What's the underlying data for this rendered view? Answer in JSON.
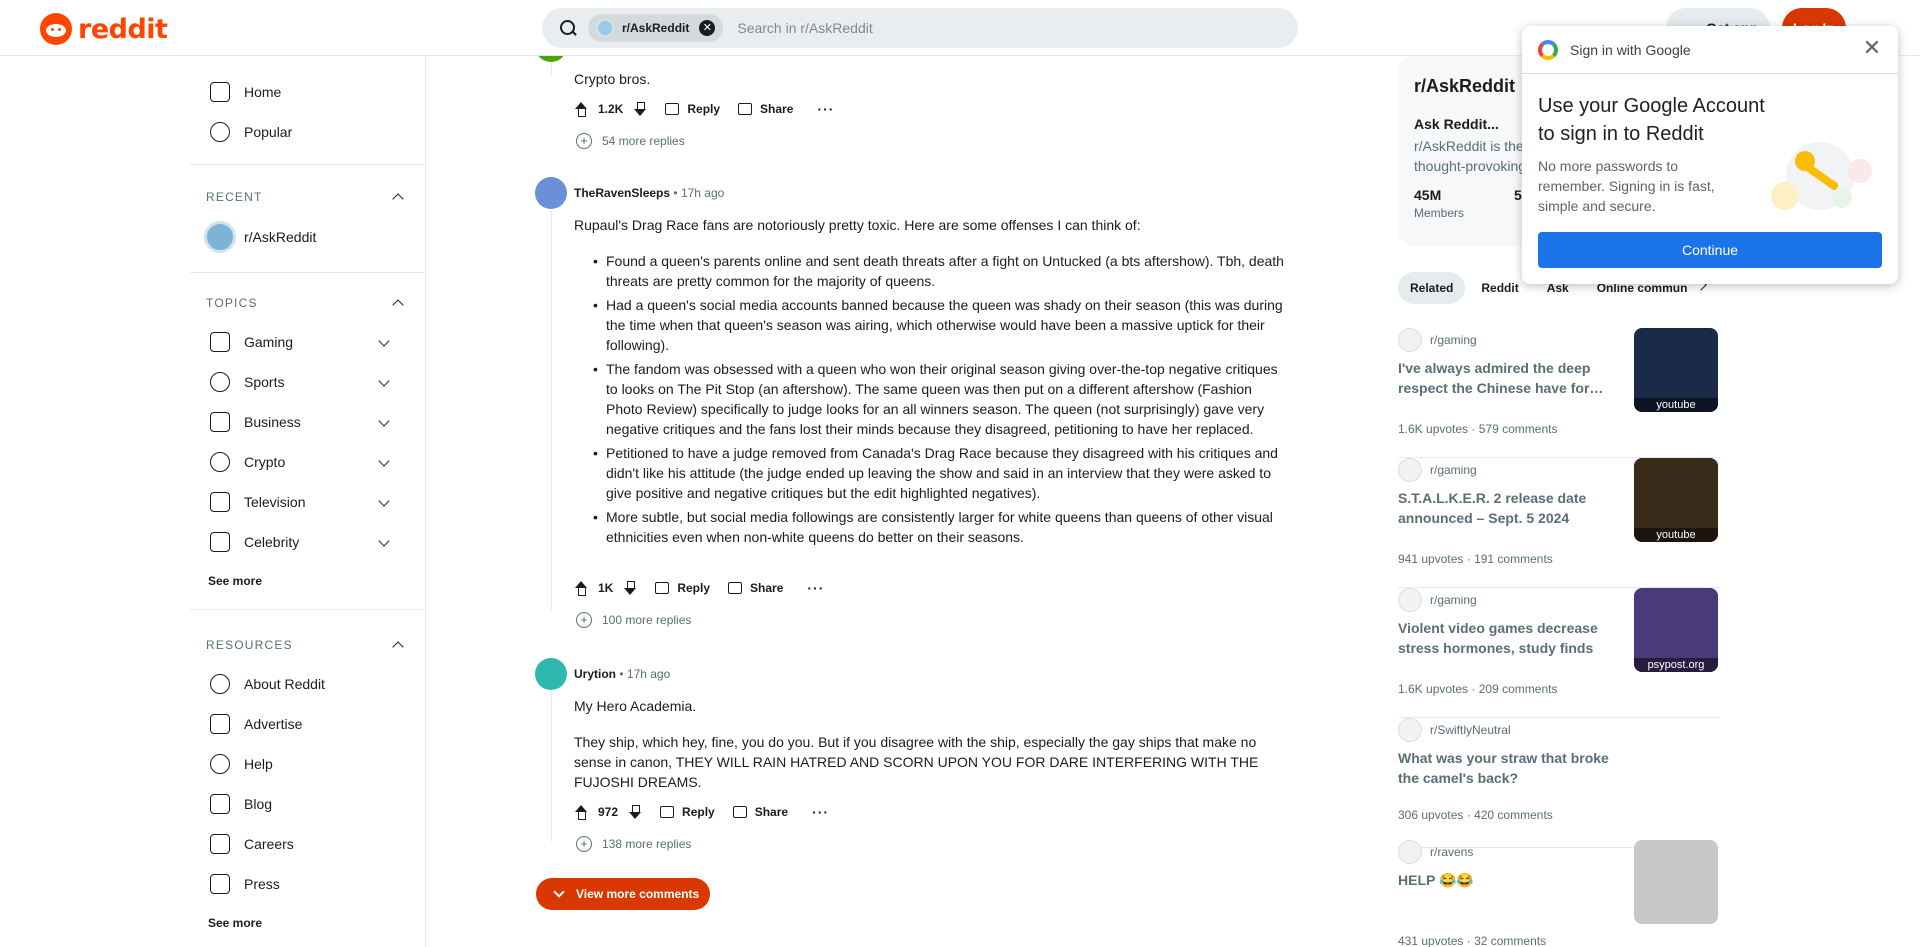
{
  "header": {
    "logo_text": "reddit",
    "search_chip": "r/AskReddit",
    "search_placeholder": "Search in r/AskReddit",
    "get_app": "Get app",
    "login": "Log In"
  },
  "sidebar": {
    "nav": [
      {
        "label": "Home",
        "icon": "home-icon"
      },
      {
        "label": "Popular",
        "icon": "popular-icon"
      }
    ],
    "recent_title": "RECENT",
    "recent_items": [
      {
        "label": "r/AskReddit"
      }
    ],
    "topics_title": "TOPICS",
    "topics": [
      {
        "label": "Gaming",
        "icon": "gamepad-icon"
      },
      {
        "label": "Sports",
        "icon": "ball-icon"
      },
      {
        "label": "Business",
        "icon": "chart-icon"
      },
      {
        "label": "Crypto",
        "icon": "crypto-icon"
      },
      {
        "label": "Television",
        "icon": "tv-icon"
      },
      {
        "label": "Celebrity",
        "icon": "star-icon"
      }
    ],
    "see_more_1": "See more",
    "resources_title": "RESOURCES",
    "resources": [
      {
        "label": "About Reddit",
        "icon": "reddit-icon"
      },
      {
        "label": "Advertise",
        "icon": "megaphone-icon"
      },
      {
        "label": "Help",
        "icon": "help-icon"
      },
      {
        "label": "Blog",
        "icon": "book-icon"
      },
      {
        "label": "Careers",
        "icon": "wrench-icon"
      },
      {
        "label": "Press",
        "icon": "pen-icon"
      }
    ],
    "see_more_2": "See more"
  },
  "comments": [
    {
      "text": "Crypto bros.",
      "votes": "1.2K",
      "more_replies": "54 more replies"
    },
    {
      "author": "TheRavenSleeps",
      "time": "17h ago",
      "intro": "Rupaul's Drag Race fans are notoriously pretty toxic. Here are some offenses I can think of:",
      "bullets": [
        "Found a queen's parents online and sent death threats after a fight on Untucked (a bts aftershow). Tbh, death threats are pretty common for the majority of queens.",
        "Had a queen's social media accounts banned because the queen was shady on their season (this was during the time when that queen's season was airing, which otherwise would have been a massive uptick for their following).",
        "The fandom was obsessed with a queen who won their original season giving over-the-top negative critiques to looks on The Pit Stop (an aftershow). The same queen was then put on a different aftershow (Fashion Photo Review) specifically to judge looks for an all winners season. The queen (not surprisingly) gave very negative critiques and the fans lost their minds because they disagreed, petitioning to have her replaced.",
        "Petitioned to have a judge removed from Canada's Drag Race because they disagreed with his critiques and didn't like his attitude (the judge ended up leaving the show and said in an interview that they were asked to give positive and negative critiques but the edit highlighted negatives).",
        "More subtle, but social media followings are consistently larger for white queens than queens of other visual ethnicities even when non-white queens do better on their seasons."
      ],
      "votes": "1K",
      "more_replies": "100 more replies"
    },
    {
      "author": "Urytion",
      "time": "17h ago",
      "p1": "My Hero Academia.",
      "p2": "They ship, which hey, fine, you do you. But if you disagree with the ship, especially the gay ships that make no sense in canon, THEY WILL RAIN HATRED AND SCORN UPON YOU FOR DARE INTERFERING WITH THE FUJOSHI DREAMS.",
      "votes": "972",
      "more_replies": "138 more replies"
    }
  ],
  "actions": {
    "reply": "Reply",
    "share": "Share",
    "more": "···",
    "meta_sep": "•"
  },
  "view_more": "View more comments",
  "subreddit_card": {
    "title": "r/AskReddit",
    "tagline": "Ask Reddit...",
    "desc": "r/AskReddit is the place to ask and answer thought-provoking questions.",
    "members": "45M",
    "members_label": "Members",
    "online_prefix": "5"
  },
  "tabs": [
    "Related",
    "Reddit",
    "Ask",
    "Online commun"
  ],
  "related_posts": [
    {
      "sub": "r/gaming",
      "title": "I've always admired the deep respect the Chinese have for…",
      "upvotes": "1.6K upvotes",
      "comments": "579 comments",
      "thumb": "youtube",
      "thumb_color": "#1a2b4a"
    },
    {
      "sub": "r/gaming",
      "title": "S.T.A.L.K.E.R. 2 release date announced – Sept. 5 2024",
      "upvotes": "941 upvotes",
      "comments": "191 comments",
      "thumb": "youtube",
      "thumb_color": "#3a2a1a"
    },
    {
      "sub": "r/gaming",
      "title": "Violent video games decrease stress hormones, study finds",
      "upvotes": "1.6K upvotes",
      "comments": "209 comments",
      "thumb": "psypost.org",
      "thumb_color": "#4a3a7a"
    },
    {
      "sub": "r/SwiftlyNeutral",
      "title": "What was your straw that broke the camel's back?",
      "upvotes": "306 upvotes",
      "comments": "420 comments",
      "thumb": "",
      "thumb_color": ""
    },
    {
      "sub": "r/ravens",
      "title": "HELP 😂😂",
      "upvotes": "431 upvotes",
      "comments": "32 comments",
      "thumb": "",
      "thumb_color": "#c8c8c8"
    }
  ],
  "stats_sep": "·",
  "google_popup": {
    "header": "Sign in with Google",
    "title": "Use your Google Account to sign in to Reddit",
    "body": "No more passwords to remember. Signing in is fast, simple and secure.",
    "continue": "Continue"
  }
}
